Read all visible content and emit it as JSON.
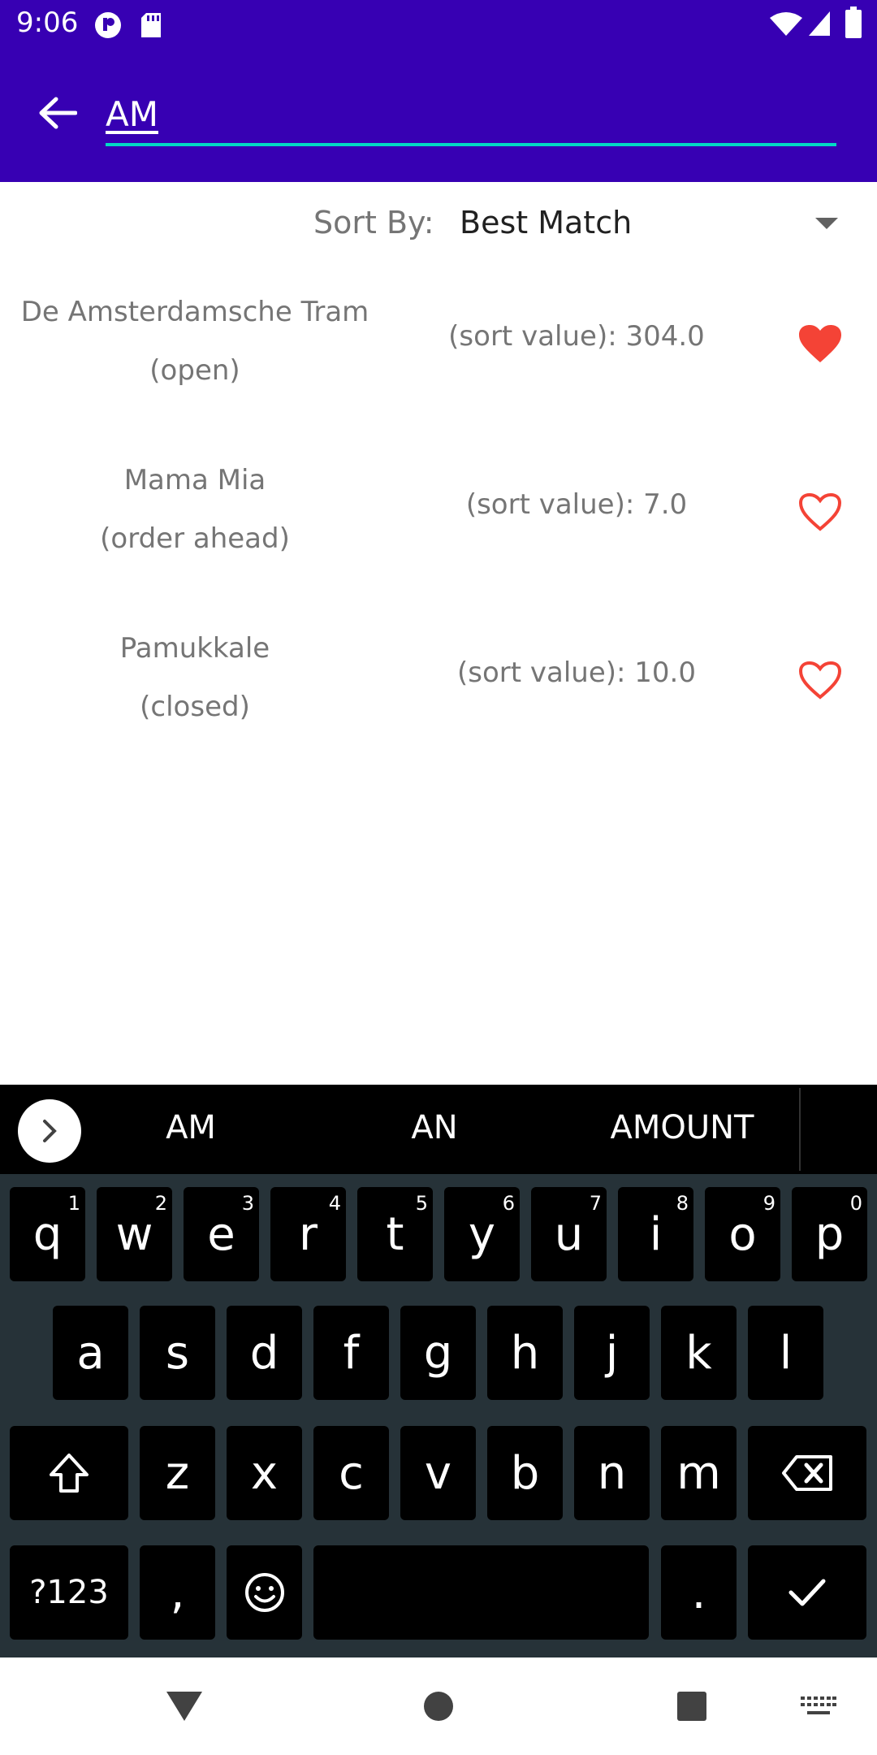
{
  "status_bar": {
    "time": "9:06"
  },
  "search": {
    "query": "AM"
  },
  "sort": {
    "label": "Sort By:",
    "selected": "Best Match"
  },
  "results": [
    {
      "name": "De Amsterdamsche Tram",
      "status": "(open)",
      "sort_value": "(sort value): 304.0",
      "favorite": true
    },
    {
      "name": "Mama Mia",
      "status": "(order ahead)",
      "sort_value": "(sort value): 7.0",
      "favorite": false
    },
    {
      "name": "Pamukkale",
      "status": "(closed)",
      "sort_value": "(sort value): 10.0",
      "favorite": false
    }
  ],
  "keyboard": {
    "suggestions": [
      "AM",
      "AN",
      "AMOUNT"
    ],
    "row1": [
      {
        "key": "q",
        "hint": "1"
      },
      {
        "key": "w",
        "hint": "2"
      },
      {
        "key": "e",
        "hint": "3"
      },
      {
        "key": "r",
        "hint": "4"
      },
      {
        "key": "t",
        "hint": "5"
      },
      {
        "key": "y",
        "hint": "6"
      },
      {
        "key": "u",
        "hint": "7"
      },
      {
        "key": "i",
        "hint": "8"
      },
      {
        "key": "o",
        "hint": "9"
      },
      {
        "key": "p",
        "hint": "0"
      }
    ],
    "row2": [
      "a",
      "s",
      "d",
      "f",
      "g",
      "h",
      "j",
      "k",
      "l"
    ],
    "row3": [
      "z",
      "x",
      "c",
      "v",
      "b",
      "n",
      "m"
    ],
    "symbols_label": "?123",
    "comma": ",",
    "period": "."
  },
  "colors": {
    "app_bar": "#3700b3",
    "accent": "#03dac5",
    "heart": "#f44336"
  }
}
